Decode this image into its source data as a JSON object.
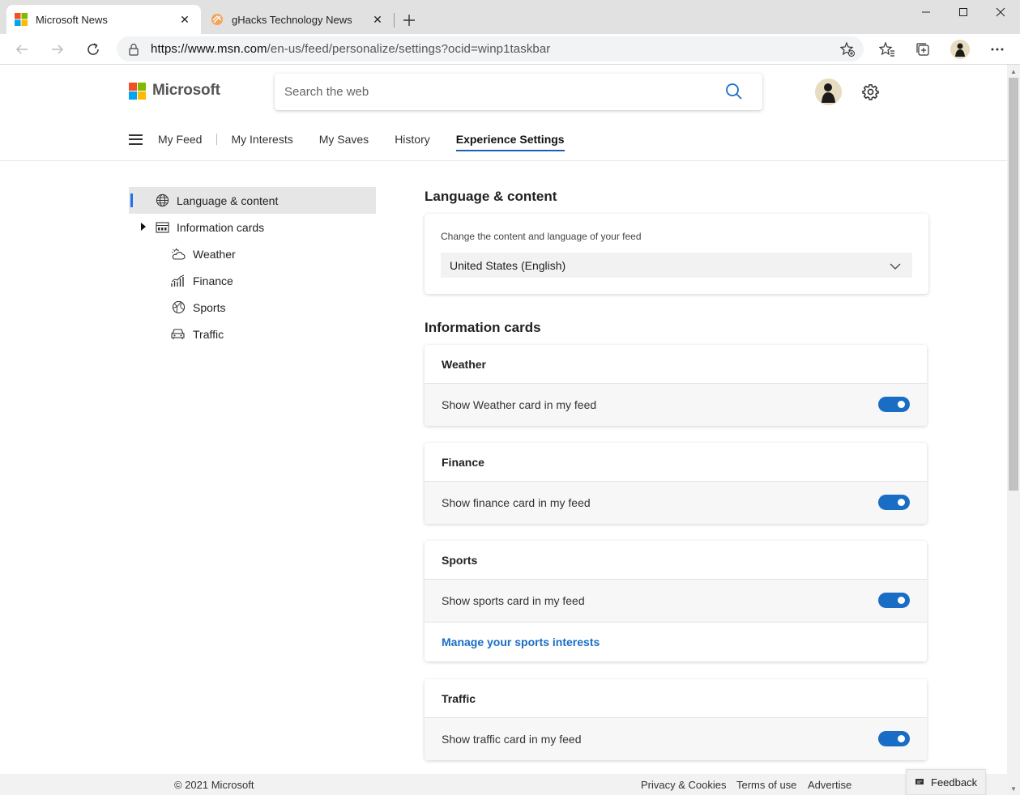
{
  "browser": {
    "tabs": [
      {
        "title": "Microsoft News"
      },
      {
        "title": "gHacks Technology News"
      }
    ],
    "url_host": "https://www.msn.com",
    "url_path": "/en-us/feed/personalize/settings?ocid=winp1taskbar"
  },
  "header": {
    "brand": "Microsoft",
    "search_placeholder": "Search the web",
    "nav": [
      "My Feed",
      "My Interests",
      "My Saves",
      "History",
      "Experience Settings"
    ]
  },
  "sidebar": {
    "items": [
      {
        "label": "Language & content",
        "icon": "globe-icon"
      },
      {
        "label": "Information cards",
        "icon": "cards-icon"
      },
      {
        "label": "Weather",
        "icon": "weather-icon"
      },
      {
        "label": "Finance",
        "icon": "finance-icon"
      },
      {
        "label": "Sports",
        "icon": "sports-icon"
      },
      {
        "label": "Traffic",
        "icon": "traffic-icon"
      }
    ]
  },
  "language_section": {
    "title": "Language & content",
    "hint": "Change the content and language of your feed",
    "selected_language": "United States (English)"
  },
  "cards_section": {
    "title": "Information cards",
    "cards": [
      {
        "name": "Weather",
        "toggle_label": "Show Weather card in my feed",
        "enabled": true
      },
      {
        "name": "Finance",
        "toggle_label": "Show finance card in my feed",
        "enabled": true
      },
      {
        "name": "Sports",
        "toggle_label": "Show sports card in my feed",
        "enabled": true,
        "link": "Manage your sports interests"
      },
      {
        "name": "Traffic",
        "toggle_label": "Show traffic card in my feed",
        "enabled": true
      }
    ]
  },
  "footer": {
    "copyright": "© 2021 Microsoft",
    "links": [
      "Privacy & Cookies",
      "Terms of use",
      "Advertise"
    ],
    "feedback": "Feedback"
  },
  "colors": {
    "accent": "#1a6dc5",
    "ms_red": "#f25022",
    "ms_green": "#7fba00",
    "ms_blue": "#00a4ef",
    "ms_yellow": "#ffb900"
  }
}
